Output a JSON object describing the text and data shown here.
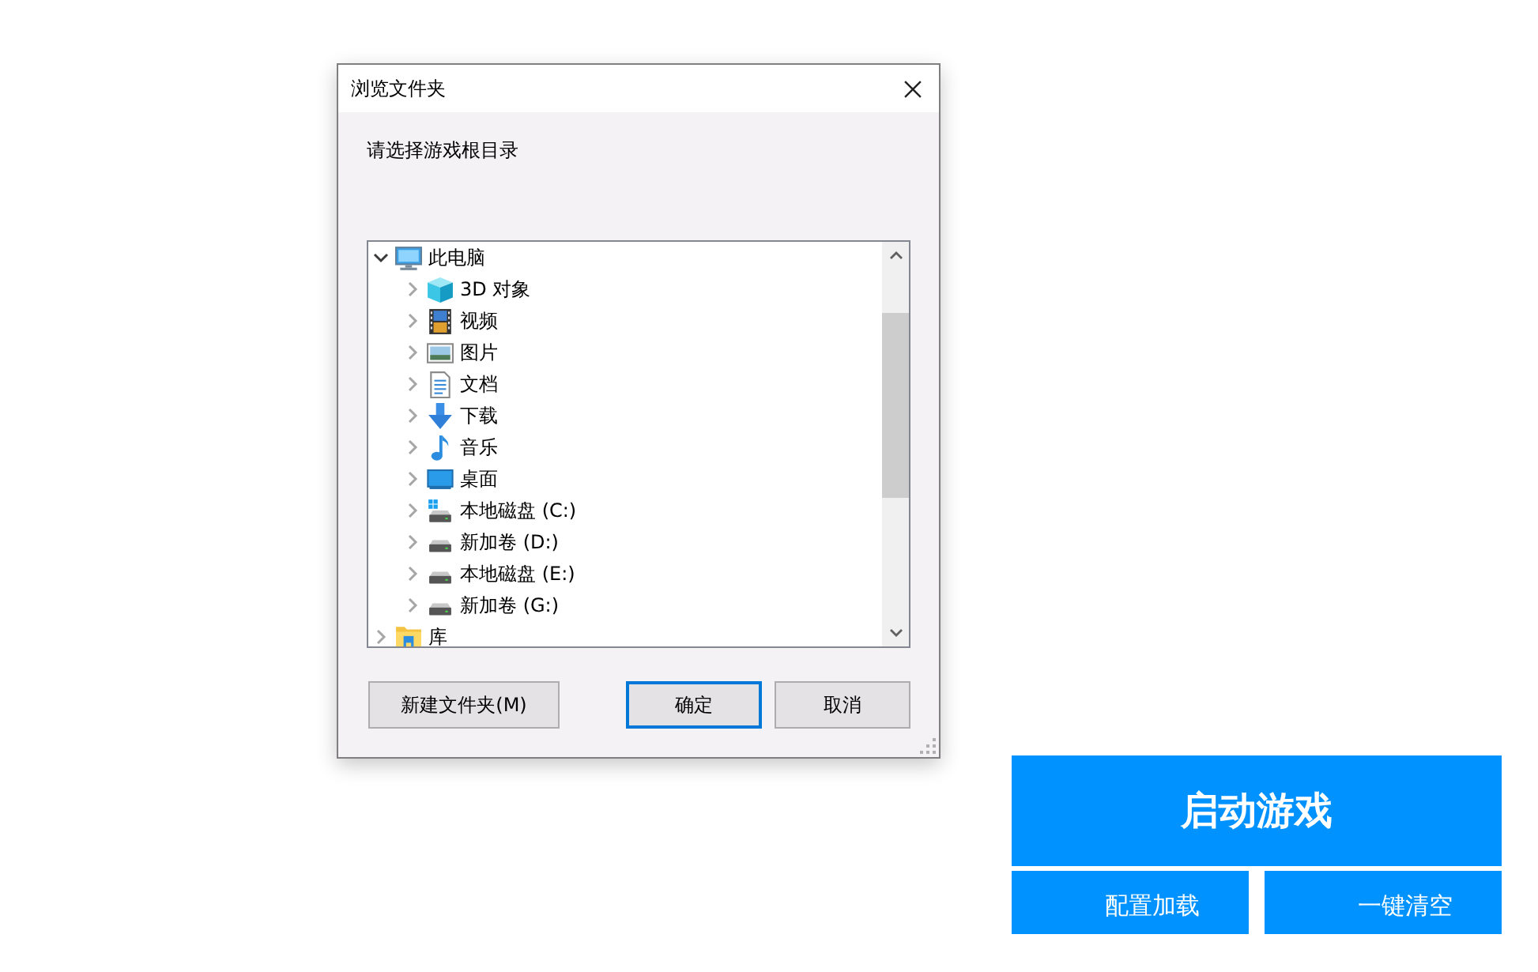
{
  "dialog": {
    "title": "浏览文件夹",
    "prompt": "请选择游戏根目录",
    "tree": [
      {
        "label": "此电脑",
        "kind": "computer",
        "expanded": true,
        "children": [
          {
            "label": "3D 对象",
            "kind": "objects",
            "expanded": false
          },
          {
            "label": "视频",
            "kind": "videos",
            "expanded": false
          },
          {
            "label": "图片",
            "kind": "pictures",
            "expanded": false
          },
          {
            "label": "文档",
            "kind": "documents",
            "expanded": false
          },
          {
            "label": "下载",
            "kind": "downloads",
            "expanded": false
          },
          {
            "label": "音乐",
            "kind": "music",
            "expanded": false
          },
          {
            "label": "桌面",
            "kind": "desktop",
            "expanded": false
          },
          {
            "label": "本地磁盘 (C:)",
            "kind": "sysdrive",
            "expanded": false
          },
          {
            "label": "新加卷 (D:)",
            "kind": "drive",
            "expanded": false
          },
          {
            "label": "本地磁盘 (E:)",
            "kind": "drive",
            "expanded": false
          },
          {
            "label": "新加卷 (G:)",
            "kind": "drive",
            "expanded": false
          }
        ]
      },
      {
        "label": "库",
        "kind": "library",
        "expanded": false
      }
    ],
    "buttons": [
      {
        "label": "新建文件夹(M)",
        "default": false
      },
      {
        "label": "确定",
        "default": true
      },
      {
        "label": "取消",
        "default": false
      }
    ]
  },
  "app": {
    "buttons": [
      {
        "label": "启动游戏",
        "kind": "primary"
      },
      {
        "label": "配置加载",
        "kind": "secondary"
      },
      {
        "label": "一键清空",
        "kind": "secondary"
      }
    ]
  }
}
